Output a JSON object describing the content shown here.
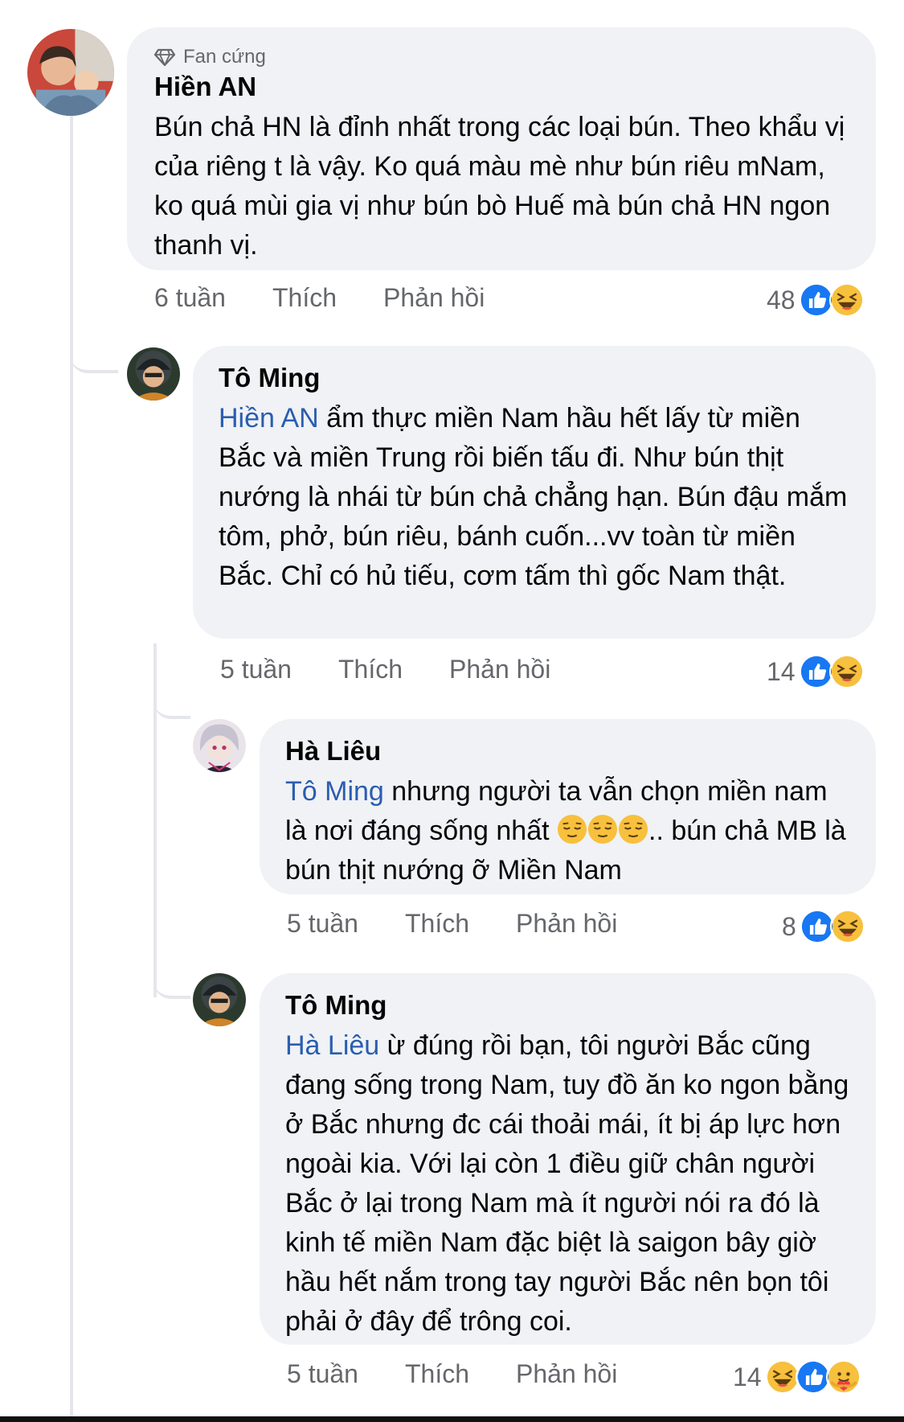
{
  "comments": [
    {
      "badge": "Fan cứng",
      "author": "Hiền AN",
      "mention": "",
      "text": "Bún chả HN là đỉnh nhất trong các loại bún. Theo khẩu vị của riêng t là vậy.  Ko quá màu mè như bún riêu mNam, ko quá mùi gia vị như bún bò Huế mà bún chả HN ngon thanh vị.",
      "time": "6 tuần",
      "like_label": "Thích",
      "reply_label": "Phản hồi",
      "reaction_count": "48",
      "reactions": [
        "like-icon",
        "haha-icon"
      ]
    },
    {
      "author": "Tô Ming",
      "mention": "Hiền AN",
      "text": " ẩm thực miền Nam hầu hết lấy từ miền Bắc và miền Trung rồi biến tấu đi. Như bún thịt nướng là nhái từ bún chả chẳng hạn. Bún đậu mắm tôm, phở, bún riêu, bánh cuốn...vv toàn từ miền Bắc. Chỉ có hủ tiếu, cơm tấm thì gốc Nam thật.",
      "time": "5 tuần",
      "like_label": "Thích",
      "reply_label": "Phản hồi",
      "reaction_count": "14",
      "reactions": [
        "like-icon",
        "haha-icon"
      ]
    },
    {
      "author": "Hà Liêu",
      "mention": "Tô Ming",
      "text_before": "  nhưng người ta vẫn chọn miền nam là nơi đáng sống nhất ",
      "emoji_count": 3,
      "text_after": ".. bún chả MB là bún thịt nướng ỡ Miền Nam",
      "time": "5 tuần",
      "like_label": "Thích",
      "reply_label": "Phản hồi",
      "reaction_count": "8",
      "reactions": [
        "like-icon",
        "haha-icon"
      ]
    },
    {
      "author": "Tô Ming",
      "mention": "Hà Liêu",
      "text": " ừ đúng rồi bạn, tôi người Bắc cũng đang sống trong Nam, tuy đồ ăn ko ngon bằng ở Bắc nhưng đc cái thoải mái, ít bị áp lực hơn ngoài kia. Với lại còn 1 điều giữ chân người Bắc ở lại trong Nam mà ít người nói ra đó là kinh tế miền Nam đặc biệt là saigon bây giờ hầu hết nắm trong tay người Bắc nên bọn tôi phải ở đây để trông coi.",
      "time": "5 tuần",
      "like_label": "Thích",
      "reply_label": "Phản hồi",
      "reaction_count": "14",
      "reactions": [
        "haha-icon",
        "like-icon",
        "care-icon"
      ]
    }
  ],
  "colors": {
    "bubble_bg": "#f0f2f5",
    "mention": "#2a5db0",
    "meta": "#65676b",
    "like_blue": "#1877f2",
    "haha_yellow": "#f7c03d"
  }
}
